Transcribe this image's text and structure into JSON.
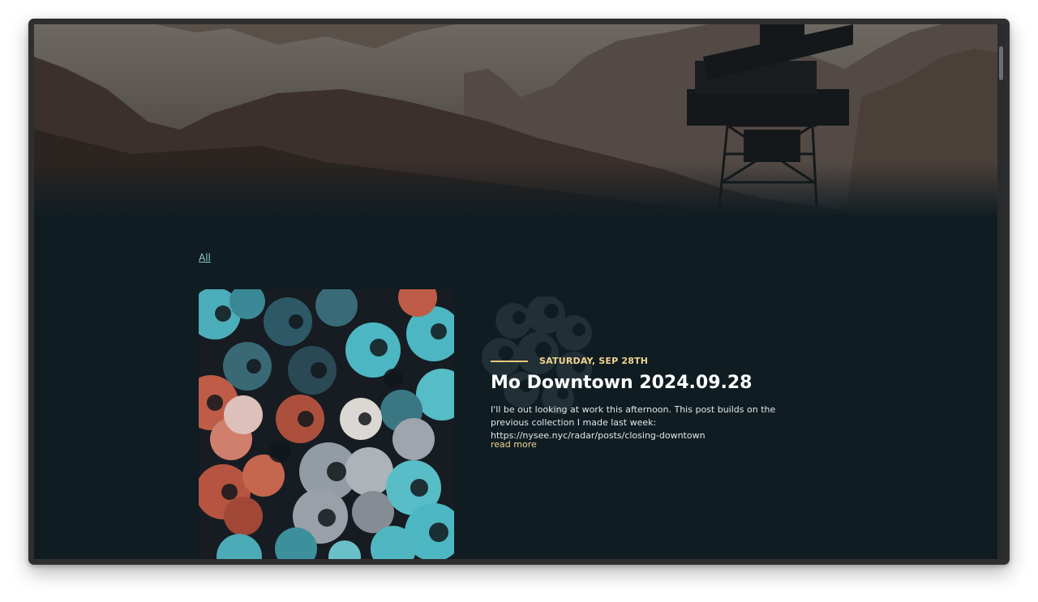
{
  "filter": {
    "label": "All"
  },
  "post": {
    "date": "SATURDAY, SEP 28TH",
    "title": "Mo Downtown 2024.09.28",
    "excerpt": "I'll be out looking at work this afternoon. This post builds on the previous collection I made last week: https://nysee.nyc/radar/posts/closing-downtown",
    "read_more": "read more",
    "image_alt": "Abstract pattern of overlapping swirled flower shapes in teal, coral, white and grey"
  },
  "colors": {
    "background": "#0f1c22",
    "link": "#8ad2cf",
    "accent": "#f0d38e",
    "title": "#ffffff",
    "teal": "#4fc0cc",
    "coral": "#c8604a",
    "grey": "#9aa3ad"
  }
}
